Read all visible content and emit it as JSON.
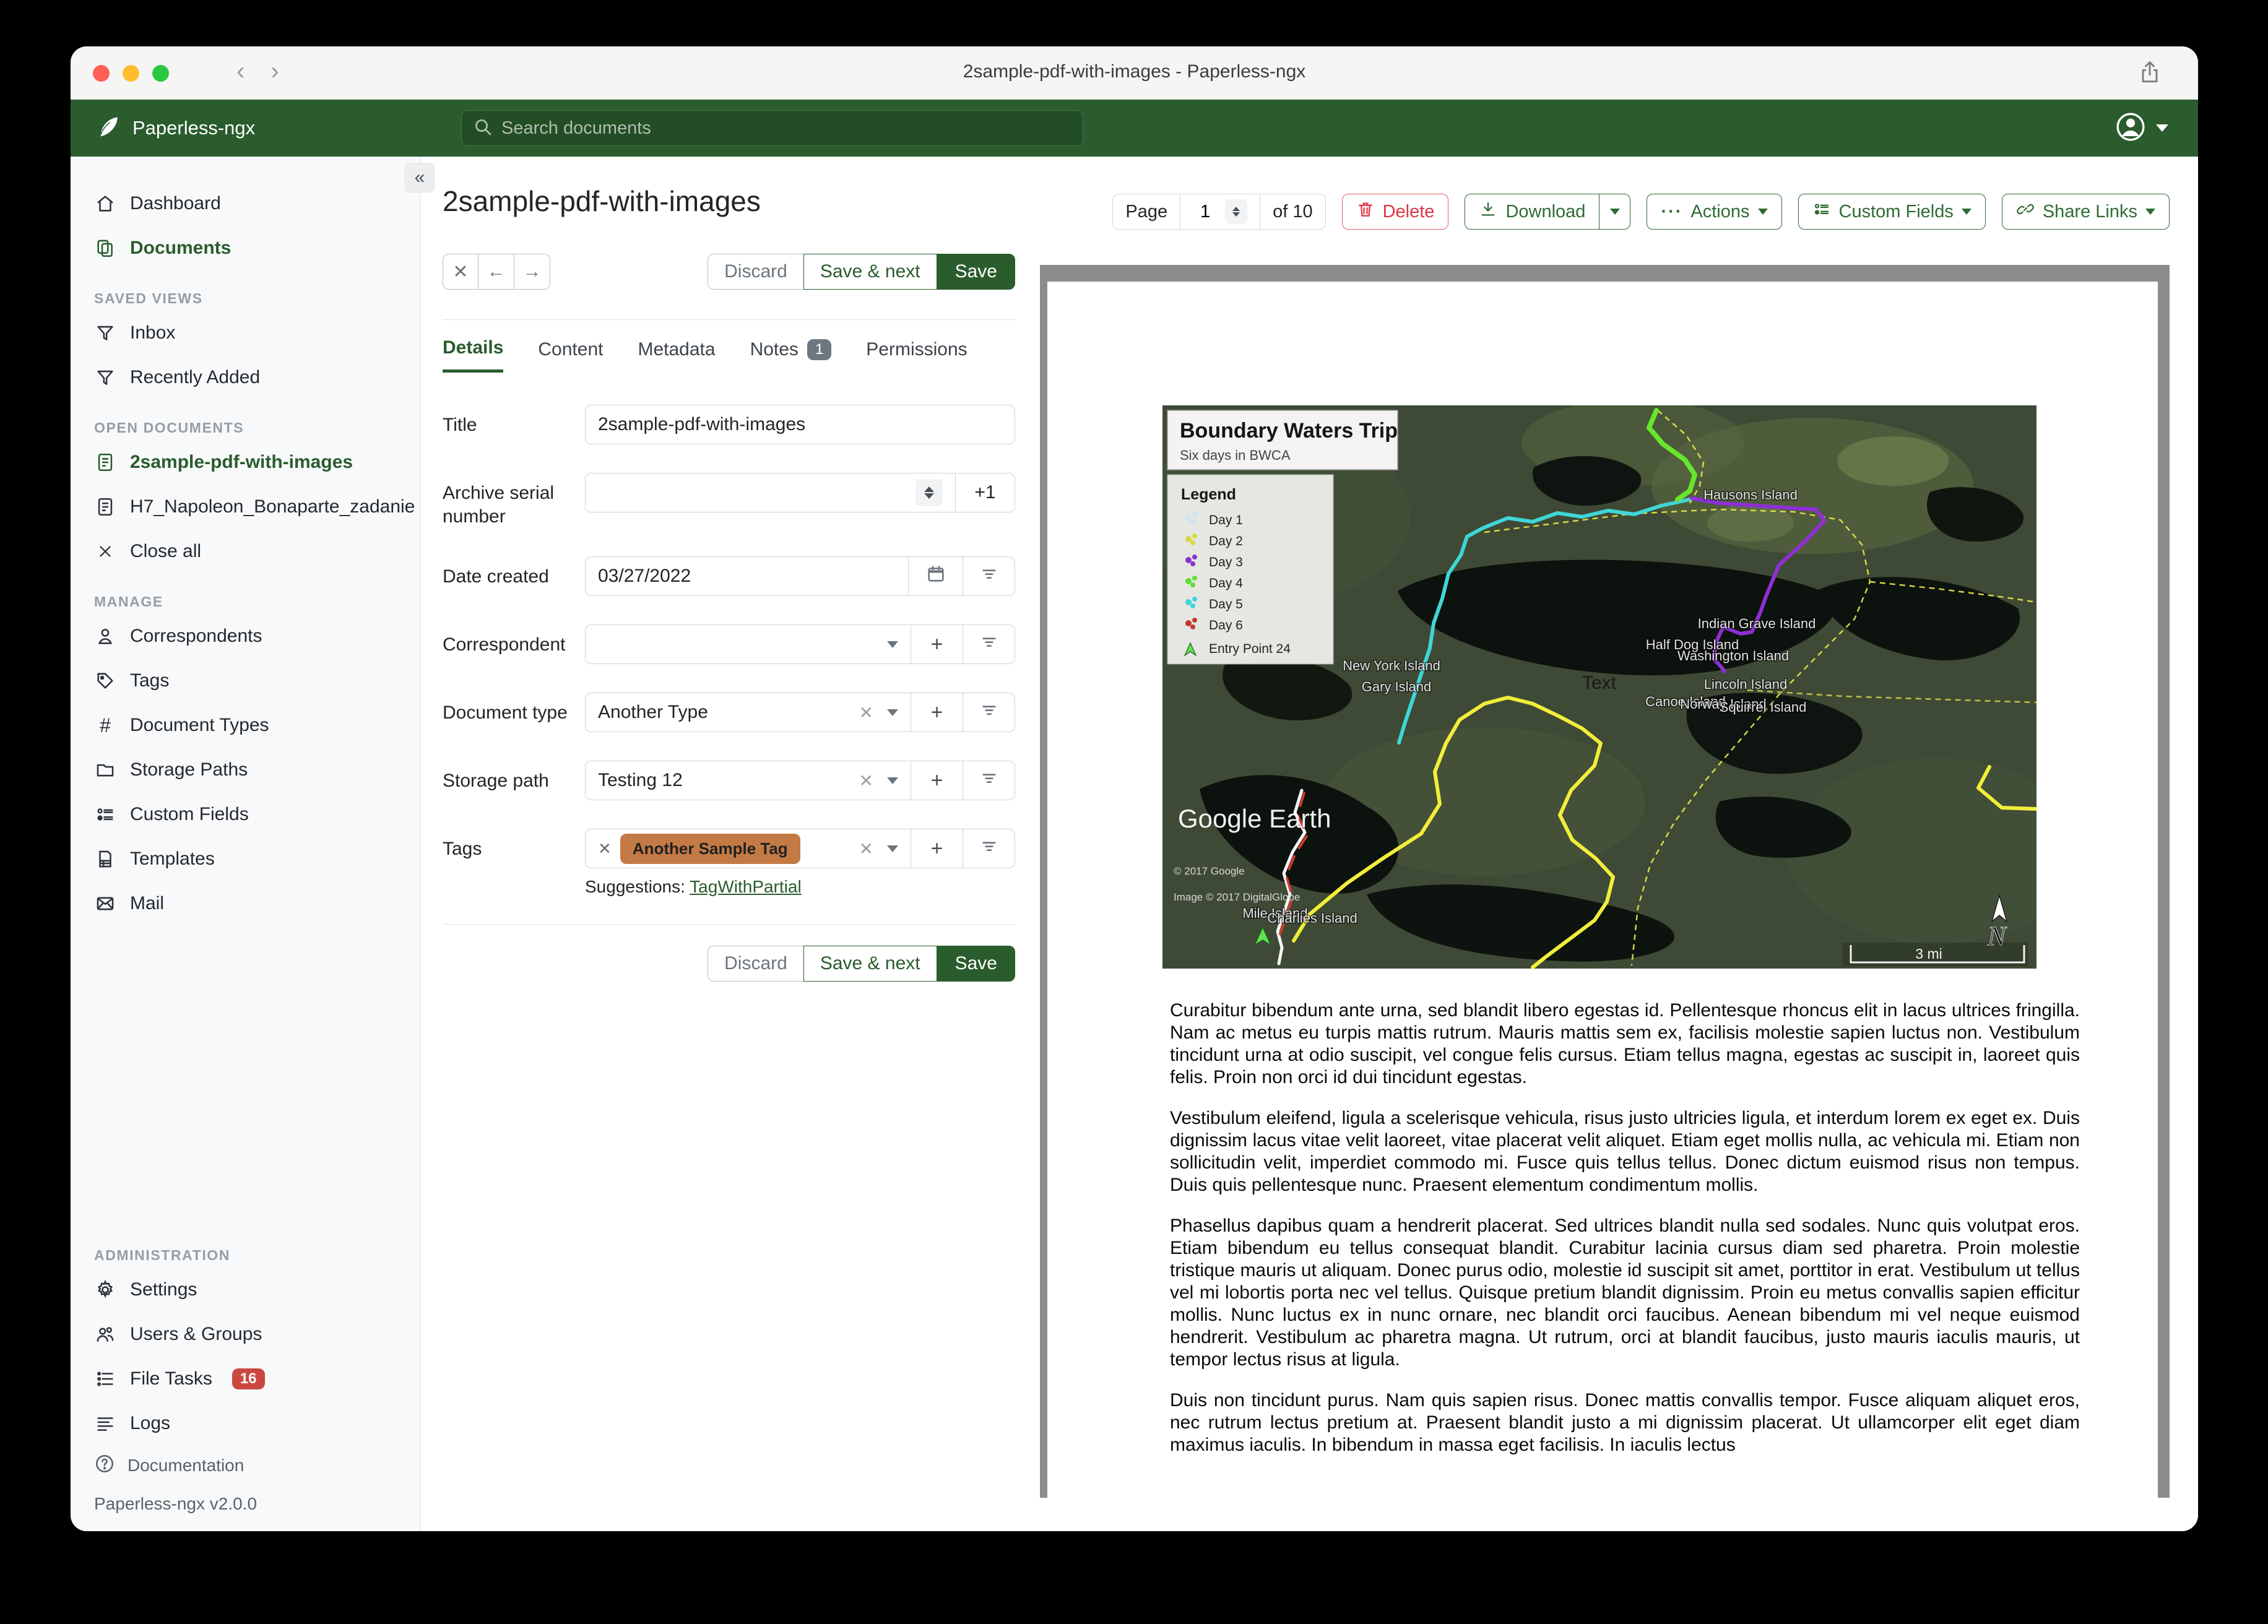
{
  "window": {
    "title": "2sample-pdf-with-images - Paperless-ngx"
  },
  "header": {
    "brand": "Paperless-ngx",
    "search_placeholder": "Search documents"
  },
  "sidebar": {
    "dashboard": "Dashboard",
    "documents": "Documents",
    "saved_views_heading": "SAVED VIEWS",
    "saved_views": [
      {
        "label": "Inbox"
      },
      {
        "label": "Recently Added"
      }
    ],
    "open_documents_heading": "OPEN DOCUMENTS",
    "open_documents": [
      {
        "label": "2sample-pdf-with-images"
      },
      {
        "label": "H7_Napoleon_Bonaparte_zadanie"
      }
    ],
    "close_all": "Close all",
    "manage_heading": "MANAGE",
    "manage": [
      {
        "label": "Correspondents"
      },
      {
        "label": "Tags"
      },
      {
        "label": "Document Types"
      },
      {
        "label": "Storage Paths"
      },
      {
        "label": "Custom Fields"
      },
      {
        "label": "Templates"
      },
      {
        "label": "Mail"
      }
    ],
    "admin_heading": "ADMINISTRATION",
    "admin": [
      {
        "label": "Settings"
      },
      {
        "label": "Users & Groups"
      },
      {
        "label": "File Tasks",
        "badge": "16"
      },
      {
        "label": "Logs"
      }
    ],
    "documentation": "Documentation",
    "version": "Paperless-ngx v2.0.0"
  },
  "toolbar": {
    "page_label": "Page",
    "page_value": "1",
    "page_of": "of 10",
    "delete_label": "Delete",
    "download_label": "Download",
    "actions_label": "Actions",
    "actions_dots": "···",
    "custom_fields_label": "Custom Fields",
    "share_links_label": "Share Links"
  },
  "doc": {
    "title": "2sample-pdf-with-images",
    "discard_label": "Discard",
    "save_next_label": "Save & next",
    "save_label": "Save",
    "tabs": [
      {
        "label": "Details"
      },
      {
        "label": "Content"
      },
      {
        "label": "Metadata"
      },
      {
        "label": "Notes",
        "badge": "1"
      },
      {
        "label": "Permissions"
      }
    ]
  },
  "form": {
    "title_label": "Title",
    "title_value": "2sample-pdf-with-images",
    "asn_label": "Archive serial number",
    "asn_add_one": "+1",
    "date_created_label": "Date created",
    "date_created_value": "03/27/2022",
    "correspondent_label": "Correspondent",
    "document_type_label": "Document type",
    "document_type_value": "Another Type",
    "storage_path_label": "Storage path",
    "storage_path_value": "Testing 12",
    "tags_label": "Tags",
    "tag_chip": "Another Sample Tag",
    "suggestions_label": "Suggestions:",
    "suggestion_link": "TagWithPartial"
  },
  "preview": {
    "map": {
      "title": "Boundary Waters Trip",
      "subtitle": "Six days in BWCA",
      "legend_title": "Legend",
      "legend": [
        {
          "label": "Day 1",
          "color": "#cfe3f0"
        },
        {
          "label": "Day 2",
          "color": "#d9d93f"
        },
        {
          "label": "Day 3",
          "color": "#8a2fd0"
        },
        {
          "label": "Day 4",
          "color": "#5fe02e"
        },
        {
          "label": "Day 5",
          "color": "#3fd6d6"
        },
        {
          "label": "Day 6",
          "color": "#c23a33"
        },
        {
          "label": "Entry Point 24",
          "color": "#62e24e"
        }
      ],
      "islands": [
        {
          "name": "Hausons Island"
        },
        {
          "name": "New York Island"
        },
        {
          "name": "Gary Island"
        },
        {
          "name": "Indian Grave Island"
        },
        {
          "name": "Half Dog Island"
        },
        {
          "name": "Washington Island"
        },
        {
          "name": "Lincoln Island"
        },
        {
          "name": "Canoe Island"
        },
        {
          "name": "Norway Island"
        },
        {
          "name": "Squirrel Island"
        },
        {
          "name": "Mile Island"
        },
        {
          "name": "Charlies Island"
        }
      ],
      "annotation": "Text",
      "watermark": "Google Earth",
      "credit1": "© 2017 Google",
      "credit2": "Image © 2017 DigitalGlobe",
      "north_label": "N",
      "scale_label": "3 mi"
    },
    "paragraphs": [
      "Curabitur bibendum ante urna, sed blandit libero egestas id. Pellentesque rhoncus elit in lacus ultrices fringilla. Nam ac metus eu turpis mattis rutrum. Mauris mattis sem ex, facilisis molestie sapien luctus non. Vestibulum tincidunt urna at odio suscipit, vel congue felis cursus. Etiam tellus magna, egestas ac suscipit in, laoreet quis felis. Proin non orci id dui tincidunt egestas.",
      "Vestibulum eleifend, ligula a scelerisque vehicula, risus justo ultricies ligula, et interdum lorem ex eget ex. Duis dignissim lacus vitae velit laoreet, vitae placerat velit aliquet. Etiam eget mollis nulla, ac vehicula mi. Etiam non sollicitudin velit, imperdiet commodo mi. Fusce quis tellus tellus. Donec dictum euismod risus non tempus. Duis quis pellentesque nunc. Praesent elementum condimentum mollis.",
      "Phasellus dapibus quam a hendrerit placerat. Sed ultrices blandit nulla sed sodales. Nunc quis volutpat eros. Etiam bibendum eu tellus consequat blandit. Curabitur lacinia cursus diam sed pharetra. Proin molestie tristique mauris ut aliquam. Donec purus odio, molestie id suscipit sit amet, porttitor in erat. Vestibulum ut tellus vel mi lobortis porta nec vel tellus. Quisque pretium blandit dignissim. Proin eu metus convallis sapien efficitur mollis. Nunc luctus ex in nunc ornare, nec blandit orci faucibus. Aenean bibendum mi vel neque euismod hendrerit. Vestibulum ac pharetra magna. Ut rutrum, orci at blandit faucibus, justo mauris iaculis mauris, ut tempor lectus risus at ligula.",
      "Duis non tincidunt purus. Nam quis sapien risus. Donec mattis convallis tempor. Fusce aliquam aliquet eros, nec rutrum lectus pretium at. Praesent blandit justo a mi dignissim placerat. Ut ullamcorper elit eget diam maximus iaculis. In bibendum in massa eget facilisis. In iaculis lectus"
    ]
  },
  "colors": {
    "header_green": "#2a5c2d",
    "accent_green": "#2f6b33",
    "delete_red": "#dc3545",
    "tag_orange": "#c47a45",
    "badge_red": "#cb4841",
    "badge_gray": "#6e7780"
  }
}
